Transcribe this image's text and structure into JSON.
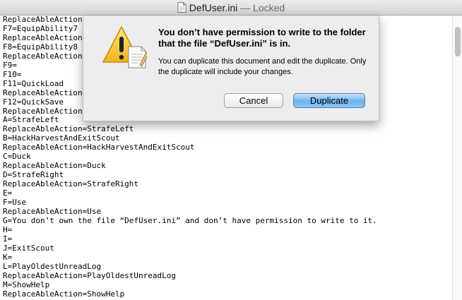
{
  "window": {
    "title": "DefUser.ini",
    "title_suffix": "— Locked"
  },
  "editor": {
    "lines": [
      "ReplaceAbleAction=",
      "F7=EquipAbility7",
      "ReplaceAbleAction=",
      "F8=EquipAbility8",
      "ReplaceAbleAction=",
      "F9=",
      "F10=",
      "F11=QuickLoad",
      "ReplaceAbleAction=",
      "F12=QuickSave",
      "ReplaceAbleAction=",
      "A=StrafeLeft",
      "ReplaceAbleAction=StrafeLeft",
      "B=HackHarvestAndExitScout",
      "ReplaceAbleAction=HackHarvestAndExitScout",
      "C=Duck",
      "ReplaceAbleAction=Duck",
      "D=StrafeRight",
      "ReplaceAbleAction=StrafeRight",
      "E=",
      "F=Use",
      "ReplaceAbleAction=Use",
      "G=You don’t own the file “DefUser.ini” and don’t have permission to write to it.",
      "H=",
      "I=",
      "J=ExitScout",
      "K=",
      "L=PlayOldestUnreadLog",
      "ReplaceAbleAction=PlayOldestUnreadLog",
      "M=ShowHelp",
      "ReplaceAbleAction=ShowHelp"
    ]
  },
  "dialog": {
    "icon": "warning-icon",
    "title": "You don’t have permission to write to the folder that the file “DefUser.ini” is in.",
    "message": "You can duplicate this document and edit the duplicate. Only the duplicate will include your changes.",
    "cancel_label": "Cancel",
    "duplicate_label": "Duplicate"
  },
  "colors": {
    "default_button": "#6cb3f0",
    "warning": "#f5c230"
  }
}
